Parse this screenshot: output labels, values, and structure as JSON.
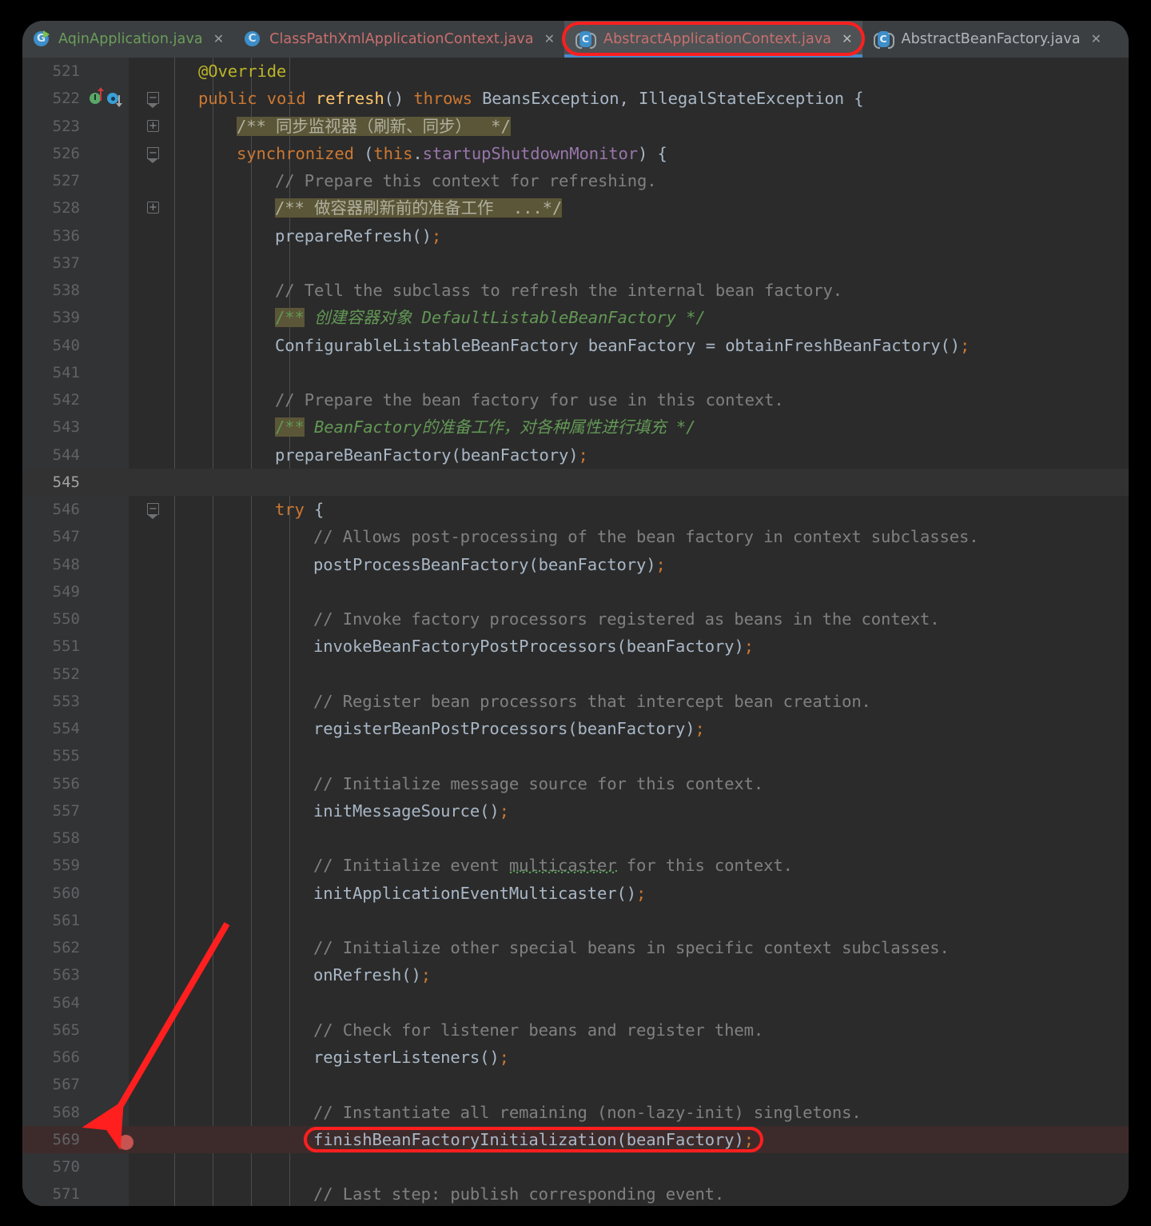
{
  "window": {
    "theme": "darcula"
  },
  "tabs": [
    {
      "label": "AqinApplication.java",
      "icon": "java-run-class-icon",
      "icon_letter": "G",
      "active": false,
      "label_color": "#6a9e5a",
      "close": "✕"
    },
    {
      "label": "ClassPathXmlApplicationContext.java",
      "icon": "java-class-icon",
      "icon_letter": "C",
      "active": false,
      "label_color": "#c96f6f",
      "close": "✕"
    },
    {
      "label": "AbstractApplicationContext.java",
      "icon": "java-abstract-class-icon",
      "icon_letter": "C",
      "active": true,
      "label_color": "#c96f6f",
      "close": "✕"
    },
    {
      "label": "AbstractBeanFactory.java",
      "icon": "java-abstract-class-icon",
      "icon_letter": "C",
      "active": false,
      "label_color": "#b0b7bd",
      "close": "✕"
    }
  ],
  "editor": {
    "file": "AbstractApplicationContext.java",
    "caret_line": 545,
    "breakpoint_line": 569,
    "line_numbers": [
      521,
      522,
      523,
      526,
      527,
      528,
      536,
      537,
      538,
      539,
      540,
      541,
      542,
      543,
      544,
      545,
      546,
      547,
      548,
      549,
      550,
      551,
      552,
      553,
      554,
      555,
      556,
      557,
      558,
      559,
      560,
      561,
      562,
      563,
      564,
      565,
      566,
      567,
      568,
      569,
      570,
      571
    ],
    "lines": {
      "l521": "@Override",
      "l522": "public void refresh() throws BeansException, IllegalStateException {",
      "l523": "/** 同步监视器（刷新、同步）  */",
      "l526": "synchronized (this.startupShutdownMonitor) {",
      "l527": "// Prepare this context for refreshing.",
      "l528": "/** 做容器刷新前的准备工作  ...*/",
      "l536": "prepareRefresh();",
      "l538": "// Tell the subclass to refresh the internal bean factory.",
      "l539": "/** 创建容器对象 DefaultListableBeanFactory */",
      "l540": "ConfigurableListableBeanFactory beanFactory = obtainFreshBeanFactory();",
      "l542": "// Prepare the bean factory for use in this context.",
      "l543": "/** BeanFactory的准备工作，对各种属性进行填充 */",
      "l544": "prepareBeanFactory(beanFactory);",
      "l546": "try {",
      "l547": "// Allows post-processing of the bean factory in context subclasses.",
      "l548": "postProcessBeanFactory(beanFactory);",
      "l550": "// Invoke factory processors registered as beans in the context.",
      "l551": "invokeBeanFactoryPostProcessors(beanFactory);",
      "l553": "// Register bean processors that intercept bean creation.",
      "l554": "registerBeanPostProcessors(beanFactory);",
      "l556": "// Initialize message source for this context.",
      "l557": "initMessageSource();",
      "l559": "// Initialize event multicaster for this context.",
      "l560": "initApplicationEventMulticaster();",
      "l562": "// Initialize other special beans in specific context subclasses.",
      "l563": "onRefresh();",
      "l565": "// Check for listener beans and register them.",
      "l566": "registerListeners();",
      "l568": "// Instantiate all remaining (non-lazy-init) singletons.",
      "l569": "finishBeanFactoryInitialization(beanFactory);",
      "l571": "// Last step: publish corresponding event."
    },
    "gutter_icons": {
      "line522_implemented": "implementing-method-icon",
      "line522_overriding": "overriding-method-icon",
      "line569_breakpoint": "breakpoint-icon"
    },
    "fold_markers": {
      "l522": "open",
      "l523": "collapsed",
      "l526": "open",
      "l528": "collapsed",
      "l546": "open"
    }
  },
  "annotations": {
    "tab_oval": "red-oval-highlight-active-tab",
    "code_rect": "red-rounded-rect-highlight-line-569",
    "arrow": "red-arrow-pointing-to-breakpoint",
    "color": "#ff1f1f"
  }
}
